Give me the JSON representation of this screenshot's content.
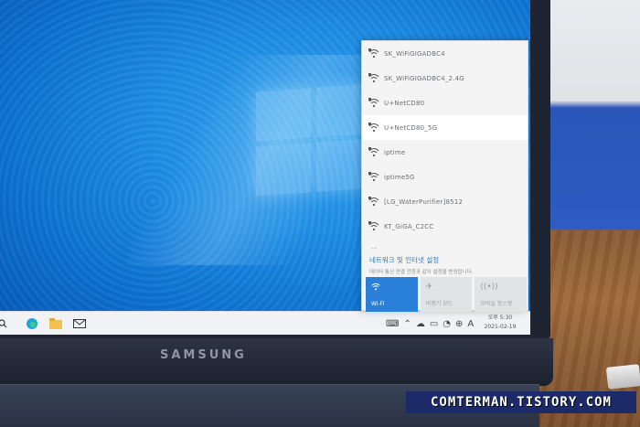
{
  "wifi_flyout": {
    "networks": [
      {
        "ssid": "SK_WiFiGIGADBC4"
      },
      {
        "ssid": "SK_WiFiGIGADBC4_2.4G"
      },
      {
        "ssid": "U+NetCD80"
      },
      {
        "ssid": "U+NetCD80_5G"
      },
      {
        "ssid": "iptime"
      },
      {
        "ssid": "iptime5G"
      },
      {
        "ssid": "[LG_WaterPurifier]8512"
      },
      {
        "ssid": "KT_GiGA_C2CC"
      }
    ],
    "more": "...",
    "settings_title": "네트워크 및 인터넷 설정",
    "settings_sub": "데이터 통신 연결 전환과 같이 설정을 변경합니다.",
    "tiles": [
      {
        "label": "Wi-Fi",
        "icon": "wifi-icon",
        "active": true
      },
      {
        "label": "비행기 모드",
        "icon": "airplane-icon",
        "active": false
      },
      {
        "label": "모바일 핫스팟",
        "icon": "hotspot-icon",
        "active": false
      }
    ]
  },
  "taskbar": {
    "tray_lang": "A",
    "clock_time": "오후 5:30",
    "clock_date": "2021-02-19"
  },
  "laptop_brand": "SAMSUNG",
  "watermark": "COMTERMAN.TISTORY.COM",
  "colors": {
    "accent": "#2a80d8",
    "desktop": "#1d8ee6",
    "watermark_bg": "#1c2a6a"
  }
}
